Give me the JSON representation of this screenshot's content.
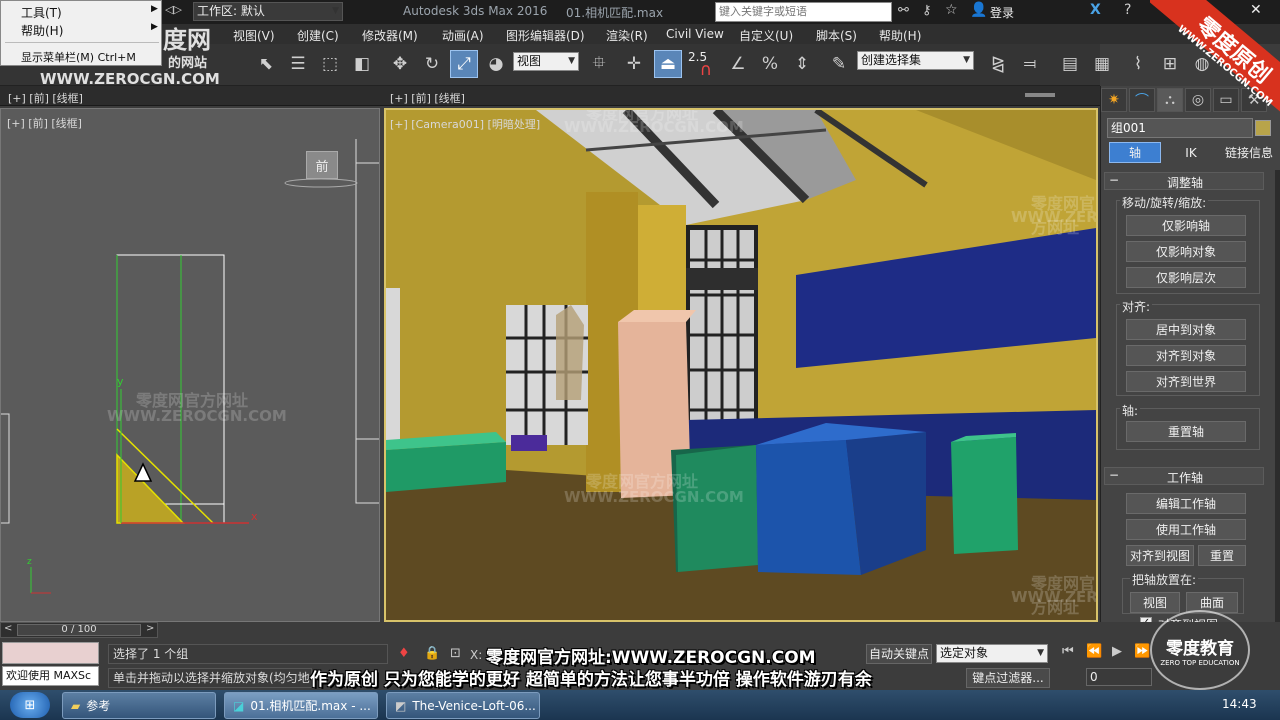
{
  "titlebar": {
    "workspace_label": "工作区: 默认",
    "app_title": "Autodesk 3ds Max 2016",
    "file_title": "01.相机匹配.max",
    "search_placeholder": "键入关键字或短语",
    "login_label": "登录"
  },
  "context_menu": {
    "items": [
      {
        "label": "工具(T)"
      },
      {
        "label": "帮助(H)"
      },
      {
        "label": "显示菜单栏(M)  Ctrl+M"
      }
    ]
  },
  "menubar": {
    "items": [
      {
        "label": "视图(V)"
      },
      {
        "label": "创建(C)"
      },
      {
        "label": "修改器(M)"
      },
      {
        "label": "动画(A)"
      },
      {
        "label": "图形编辑器(D)"
      },
      {
        "label": "渲染(R)"
      },
      {
        "label": "Civil View"
      },
      {
        "label": "自定义(U)"
      },
      {
        "label": "脚本(S)"
      },
      {
        "label": "帮助(H)"
      }
    ]
  },
  "toolbar": {
    "coord_system": "视图",
    "selection_set": "创建选择集",
    "snap_value": "2.5"
  },
  "viewports": {
    "top_left_label": "[+] [前] [线框]",
    "top_right_label": "[+] [前] [线框]",
    "left_label": "[+] [前] [线框]",
    "left_viewcube": "前",
    "axis_y": "y",
    "axis_x": "x",
    "axis_z": "z",
    "right_label": "[+] [Camera001] [明暗处理]"
  },
  "command_panel": {
    "object_name": "组001",
    "tabs": [
      {
        "label": "轴"
      },
      {
        "label": "IK"
      },
      {
        "label": "链接信息"
      }
    ],
    "adjust_pivot": {
      "title": "调整轴",
      "move_group": "移动/旋转/缩放:",
      "affect_pivot": "仅影响轴",
      "affect_object": "仅影响对象",
      "affect_hierarchy": "仅影响层次",
      "align_group": "对齐:",
      "center_to_object": "居中到对象",
      "align_to_object": "对齐到对象",
      "align_to_world": "对齐到世界",
      "pivot_group": "轴:",
      "reset_pivot": "重置轴"
    },
    "working_pivot": {
      "title": "工作轴",
      "edit": "编辑工作轴",
      "use": "使用工作轴",
      "align_to_view": "对齐到视图",
      "reset": "重置",
      "place_pivot": "把轴放置在:",
      "view": "视图",
      "surface": "曲面",
      "align_to_view_check": "对齐到视图"
    }
  },
  "timeline": {
    "frame": "0 / 100"
  },
  "status": {
    "maxscript": "欢迎使用 MAXSc",
    "selection": "选择了 1 个组",
    "prompt": "单击并拖动以选择并缩放对象(均匀地",
    "x_label": "X:",
    "auto_key": "自动关键点",
    "selected_object": "选定对象",
    "key_filter": "键点过滤器...",
    "frame_field": "0"
  },
  "subtitles": {
    "line1": "零度网官方网址:WWW.ZEROCGN.COM",
    "line2": "作为原创 只为您能学的更好 超简单的方法让您事半功倍 操作软件游刃有余"
  },
  "watermarks": {
    "site": "零度网官方网址",
    "url": "WWW.ZEROCGN.COM",
    "logo_cn": "度网",
    "logo_sub": "的网站",
    "corner_banner": "零度原创",
    "corner_url": "WWW.ZEROCGN.COM",
    "badge_cn": "零度教育",
    "badge_en": "ZERO TOP EDUCATION"
  },
  "taskbar": {
    "items": [
      {
        "label": "参考"
      },
      {
        "label": "01.相机匹配.max - ..."
      },
      {
        "label": "The-Venice-Loft-06..."
      }
    ],
    "time": "14:43"
  },
  "colors": {
    "accent": "#5a86b8",
    "active_viewport_border": "#d8c36a",
    "wall_yellow": "#b39a2c",
    "blue_box": "#1f56b0",
    "green_box": "#1f9a66",
    "brand_red": "#d8321e"
  }
}
